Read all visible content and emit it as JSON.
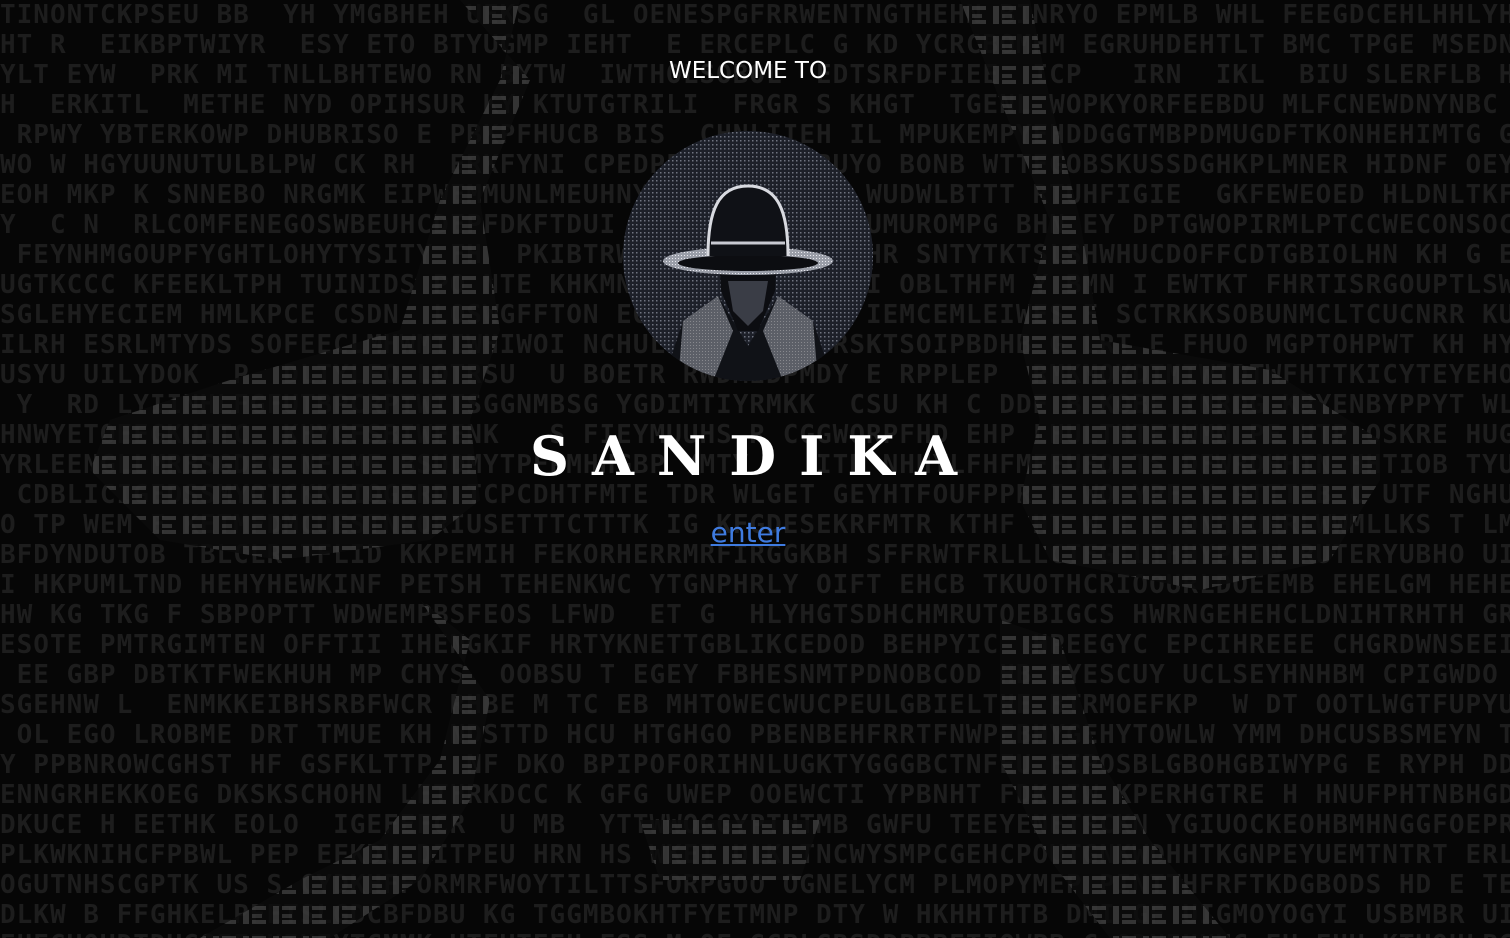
{
  "welcome_text": "WELCOME TO",
  "brand_name": "SANDIKA",
  "enter_link": "enter",
  "colors": {
    "background": "#060606",
    "text": "#ffffff",
    "link": "#3f7be0",
    "ascii_dim": "#1d1d1d",
    "ascii_bright": "#4a4a4a"
  },
  "icons": {
    "avatar": "hooded-man-in-fedora-ascii-portrait",
    "background": "biohazard-symbol-ascii-art"
  }
}
